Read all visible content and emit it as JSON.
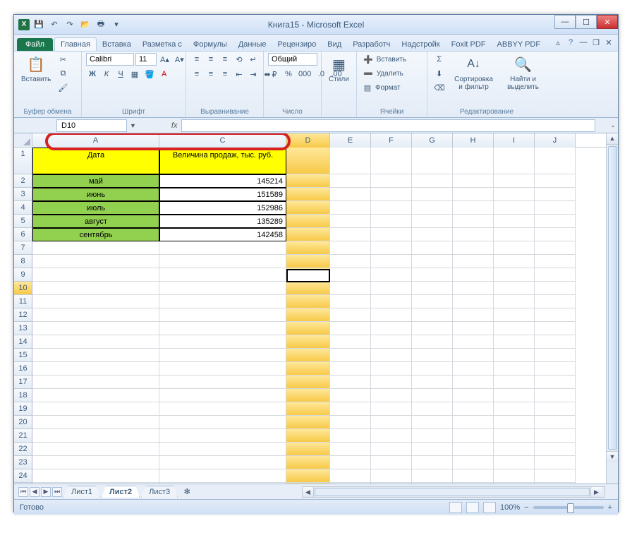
{
  "title": "Книга15 - Microsoft Excel",
  "tabs": {
    "file": "Файл",
    "home": "Главная",
    "insert": "Вставка",
    "layout": "Разметка с",
    "formulas": "Формулы",
    "data": "Данные",
    "review": "Рецензиро",
    "view": "Вид",
    "dev": "Разработч",
    "addins": "Надстройк",
    "foxit": "Foxit PDF",
    "abbyy": "ABBYY PDF"
  },
  "ribbon": {
    "paste": "Вставить",
    "clipboard": "Буфер обмена",
    "font_name": "Calibri",
    "font_size": "11",
    "font": "Шрифт",
    "alignment": "Выравнивание",
    "number_format": "Общий",
    "number": "Число",
    "styles": "Стили",
    "insert_btn": "Вставить",
    "delete_btn": "Удалить",
    "format_btn": "Формат",
    "cells": "Ячейки",
    "sort": "Сортировка и фильтр",
    "find": "Найти и выделить",
    "editing": "Редактирование"
  },
  "namebox": "D10",
  "columns": [
    "A",
    "C",
    "D",
    "E",
    "F",
    "G",
    "H",
    "I",
    "J"
  ],
  "col_widths": {
    "A": 180,
    "C": 180,
    "D": 62,
    "rest": 58
  },
  "sheet": {
    "header_a": "Дата",
    "header_c": "Величина продаж, тыс. руб.",
    "rows": [
      {
        "a": "май",
        "c": "145214"
      },
      {
        "a": "июнь",
        "c": "151589"
      },
      {
        "a": "июль",
        "c": "152986"
      },
      {
        "a": "август",
        "c": "135289"
      },
      {
        "a": "сентябрь",
        "c": "142458"
      }
    ]
  },
  "active_cell": "D10",
  "sheet_tabs": [
    "Лист1",
    "Лист2",
    "Лист3"
  ],
  "active_sheet": 1,
  "status": "Готово",
  "zoom": "100%",
  "row_count": 25,
  "colors": {
    "yellow": "#ffff00",
    "green": "#92d050",
    "highlight": "#d62222"
  },
  "chart_data": {
    "type": "table",
    "title": "Величина продаж, тыс. руб.",
    "categories": [
      "май",
      "июнь",
      "июль",
      "август",
      "сентябрь"
    ],
    "values": [
      145214,
      151589,
      152986,
      135289,
      142458
    ]
  }
}
